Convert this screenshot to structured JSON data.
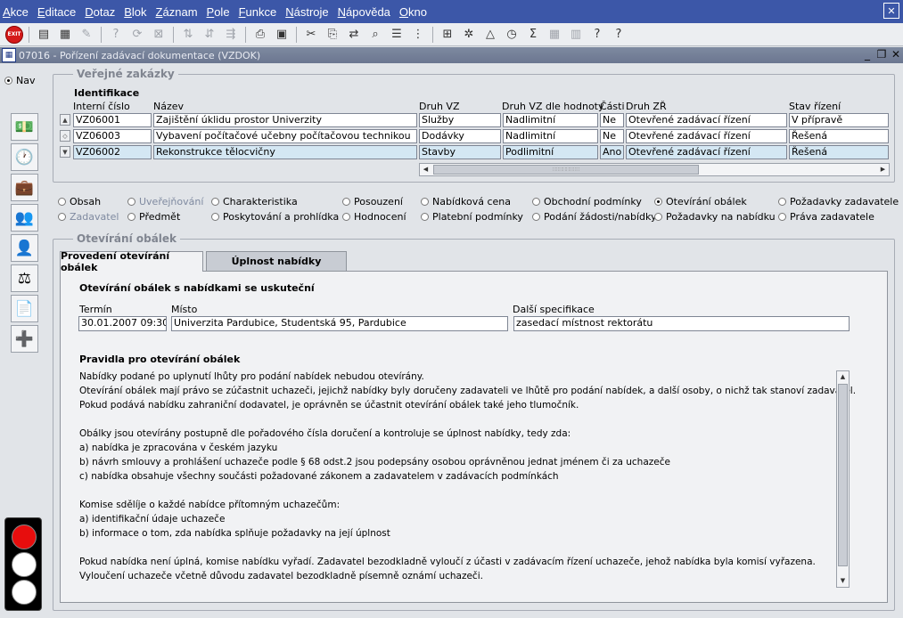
{
  "menu": [
    "Akce",
    "Editace",
    "Dotaz",
    "Blok",
    "Záznam",
    "Pole",
    "Funkce",
    "Nástroje",
    "Nápověda",
    "Okno"
  ],
  "toolbar": {
    "exit_label": "EXIT"
  },
  "window": {
    "title": "07016 - Pořízení zadávací dokumentace (VZDOK)"
  },
  "nav": {
    "label": "Nav"
  },
  "verejne": {
    "legend": "Veřejné zakázky",
    "section": "Identifikace",
    "columns": [
      "Interní číslo",
      "Název",
      "Druh VZ",
      "Druh VZ dle hodnoty",
      "Části",
      "Druh ZŘ",
      "Stav řízení"
    ],
    "rows": [
      [
        "VZ06001",
        "Zajištění úklidu prostor Univerzity",
        "Služby",
        "Nadlimitní",
        "Ne",
        "Otevřené zadávací řízení",
        "V přípravě"
      ],
      [
        "VZ06003",
        "Vybavení počítačové učebny počítačovou technikou",
        "Dodávky",
        "Nadlimitní",
        "Ne",
        "Otevřené zadávací řízení",
        "Řešená"
      ],
      [
        "VZ06002",
        "Rekonstrukce tělocvičny",
        "Stavby",
        "Podlimitní",
        "Ano",
        "Otevřené zadávací řízení",
        "Řešená"
      ]
    ]
  },
  "radios": {
    "obsah": "Obsah",
    "uverejnovani": "Uveřejňování",
    "charakteristika": "Charakteristika",
    "posouzeni": "Posouzení",
    "nabidkova_cena": "Nabídková cena",
    "obchodni_podminky": "Obchodní podmínky",
    "otevirani_obalek": "Otevírání obálek",
    "pozadavky_zadavatele": "Požadavky zadavatele",
    "zadavatel": "Zadavatel",
    "predmet": "Předmět",
    "poskytovani": "Poskytování a prohlídka",
    "hodnoceni": "Hodnocení",
    "platebni_podminky": "Platební podmínky",
    "podani": "Podání žádosti/nabídky",
    "pozadavky_na_nabidku": "Požadavky na nabídku",
    "prava_zadavatele": "Práva zadavatele"
  },
  "otevirani": {
    "legend": "Otevírání obálek",
    "tabs": [
      "Provedení otevírání obálek",
      "Úplnost nabídky"
    ],
    "heading": "Otevírání obálek s nabídkami se uskuteční",
    "termin_label": "Termín",
    "termin_value": "30.01.2007 09:30",
    "misto_label": "Místo",
    "misto_value": "Univerzita Pardubice, Studentská 95, Pardubice",
    "dalsi_label": "Další specifikace",
    "dalsi_value": "zasedací místnost rektorátu",
    "rules_heading": "Pravidla pro otevírání obálek",
    "rules_lines": [
      "Nabídky podané po uplynutí lhůty pro podání nabídek nebudou otevírány.",
      "Otevírání obálek mají právo se zúčastnit uchazeči, jejichž nabídky byly doručeny zadavateli ve lhůtě pro podání nabídek, a další osoby, o nichž tak stanoví zadavatel.",
      "Pokud podává nabídku zahraniční dodavatel, je oprávněn se účastnit otevírání obálek také jeho tlumočník.",
      "",
      "Obálky jsou otevírány postupně dle pořadového čísla doručení a kontroluje se úplnost nabídky, tedy zda:",
      "a) nabídka je zpracována v českém jazyku",
      "b) návrh smlouvy a prohlášení uchazeče podle § 68 odst.2 jsou podepsány osobou oprávněnou jednat jménem či za uchazeče",
      "c) nabídka obsahuje všechny součásti požadované zákonem a zadavatelem v zadávacích podmínkách",
      "",
      "Komise sdělíje o každé nabídce přítomným uchazečům:",
      "a) identifikační údaje uchazeče",
      "b) informace o tom, zda nabídka splňuje požadavky na její úplnost",
      "",
      "Pokud nabídka není úplná, komise nabídku vyřadí. Zadavatel bezodkladně vyloučí z účasti v zadávacím řízení uchazeče, jehož nabídka byla komisí vyřazena.",
      "Vyloučení uchazeče včetně důvodu zadavatel bezodkladně písemně oznámí uchazeči."
    ]
  }
}
